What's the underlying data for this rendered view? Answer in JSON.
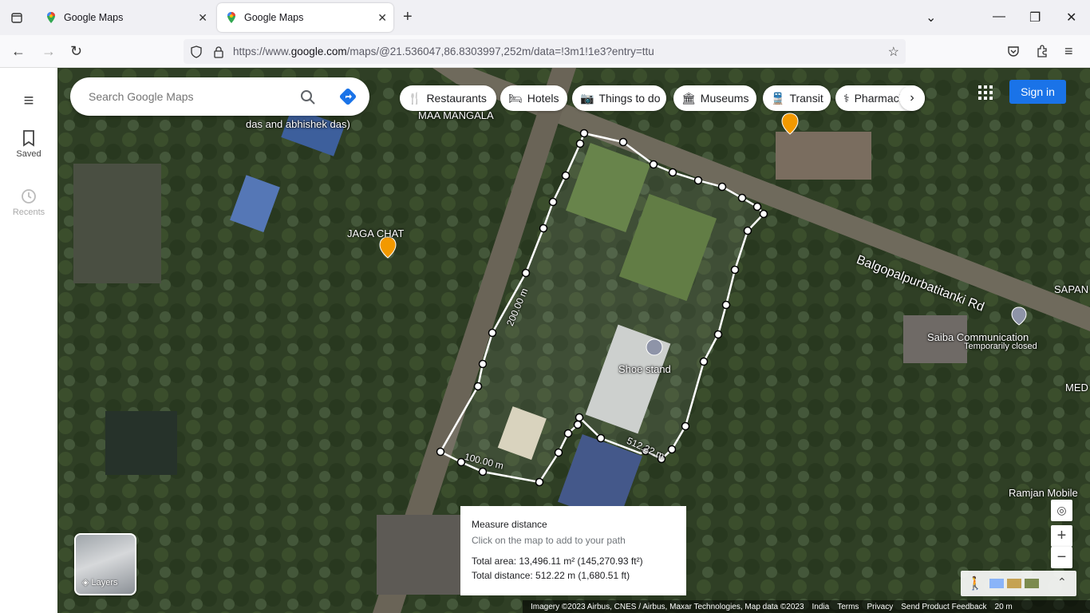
{
  "browser": {
    "tabs": [
      {
        "title": "Google Maps"
      },
      {
        "title": "Google Maps"
      }
    ],
    "url_prefix": "https://www.",
    "url_host": "google.com",
    "url_path": "/maps/@21.536047,86.8303997,252m/data=!3m1!1e3?entry=ttu"
  },
  "sidebar": {
    "saved_label": "Saved",
    "recents_label": "Recents"
  },
  "search": {
    "placeholder": "Search Google Maps"
  },
  "chips": [
    {
      "label": "Restaurants",
      "icon": "fork-knife-icon"
    },
    {
      "label": "Hotels",
      "icon": "bed-icon"
    },
    {
      "label": "Things to do",
      "icon": "camera-icon"
    },
    {
      "label": "Museums",
      "icon": "museum-icon"
    },
    {
      "label": "Transit",
      "icon": "train-icon"
    },
    {
      "label": "Pharmacies",
      "icon": "pharmacy-icon"
    }
  ],
  "signin_label": "Sign in",
  "map_labels": {
    "maa_mangala": "MAA MANGALA",
    "das_abhishek": "das and abhishek das)",
    "jaga_chat": "JAGA CHAT",
    "road": "Balgopalpurbatitanki Rd",
    "sapan": "SAPAN",
    "saiba": "Saiba Communication",
    "saiba_status": "Temporarily closed",
    "med": "MED",
    "shoe_stand": "Shoe stand",
    "ramjan": "Ramjan Mobile",
    "seg_200": "200.00 m",
    "seg_100": "100.00 m",
    "seg_512": "512.22 m"
  },
  "measure": {
    "title": "Measure distance",
    "hint": "Click on the map to add to your path",
    "total_area": "Total area: 13,496.11 m² (145,270.93 ft²)",
    "total_distance": "Total distance: 512.22 m (1,680.51 ft)"
  },
  "layers_label": "Layers",
  "footer": {
    "imagery": "Imagery ©2023 Airbus, CNES / Airbus, Maxar Technologies, Map data ©2023",
    "india": "India",
    "terms": "Terms",
    "privacy": "Privacy",
    "feedback": "Send Product Feedback",
    "scale": "20 m"
  },
  "colors": {
    "accent": "#1a73e8",
    "path": "#ffffff",
    "pin_orange": "#f29900"
  }
}
